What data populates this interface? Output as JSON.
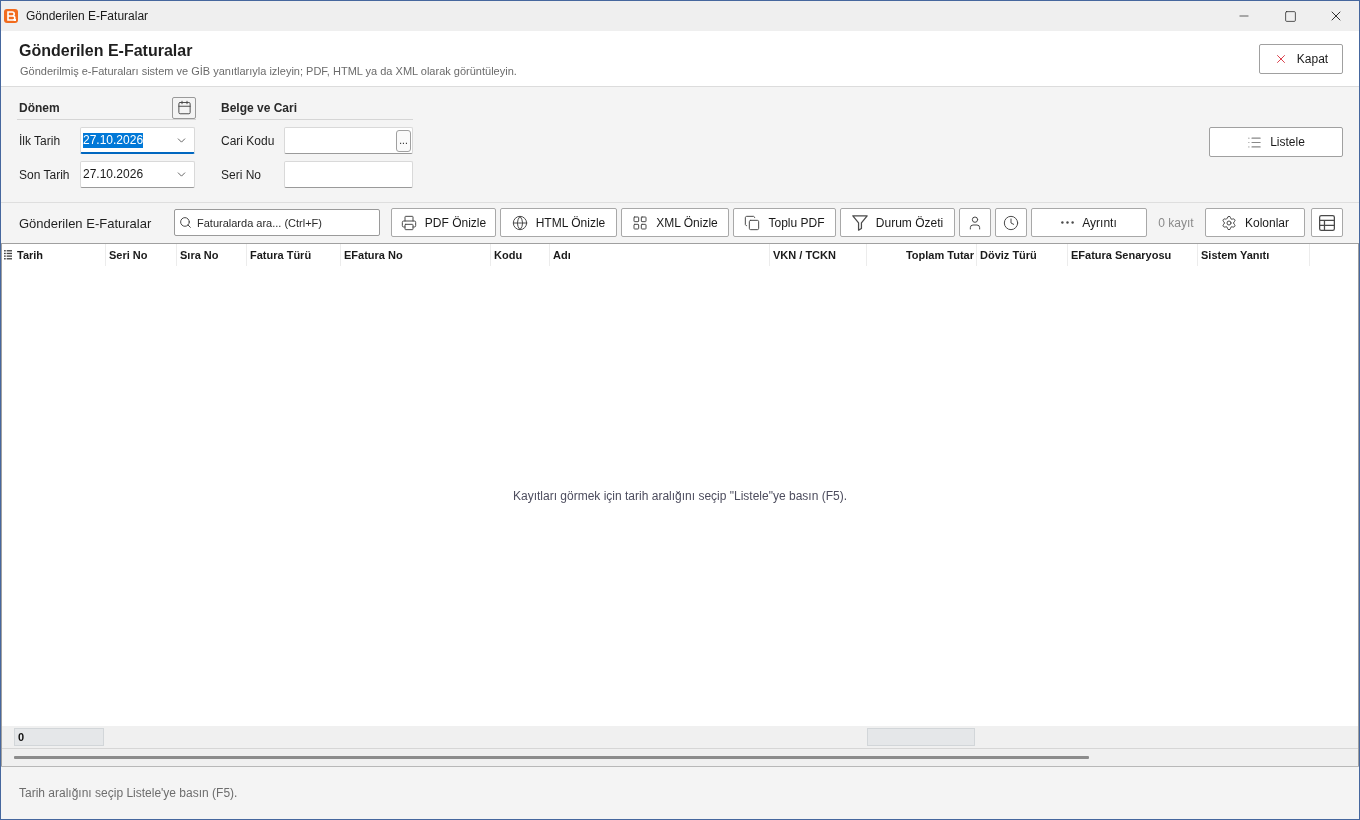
{
  "window": {
    "title": "Gönderilen E-Faturalar"
  },
  "header": {
    "title": "Gönderilen E-Faturalar",
    "subtitle": "Gönderilmiş e-Faturaları sistem ve GİB yanıtlarıyla izleyin; PDF, HTML ya da XML olarak görüntüleyin.",
    "close_button": "Kapat"
  },
  "filters": {
    "period": {
      "title": "Dönem",
      "fields": [
        {
          "label": "İlk Tarih",
          "value": "27.10.2026",
          "focused": true
        },
        {
          "label": "Son Tarih",
          "value": "27.10.2026",
          "focused": false
        }
      ]
    },
    "document": {
      "title": "Belge ve Cari",
      "fields": [
        {
          "label": "Cari Kodu",
          "kind": "lookup",
          "lookup_button": "..."
        },
        {
          "label": "Seri No",
          "kind": "text"
        }
      ]
    },
    "list_button": "Listele"
  },
  "toolbar": {
    "title": "Gönderilen E-Faturalar",
    "search": {
      "placeholder": "Faturalarda ara... (Ctrl+F)"
    },
    "items": [
      {
        "kind": "button",
        "label": "PDF Önizle"
      },
      {
        "kind": "button",
        "label": "HTML Önizle"
      },
      {
        "kind": "button",
        "label": "XML Önizle"
      },
      {
        "kind": "button",
        "label": "Toplu PDF"
      },
      {
        "kind": "button",
        "label": "Durum Özeti"
      },
      {
        "kind": "icon_button"
      },
      {
        "kind": "icon_button"
      },
      {
        "kind": "button",
        "label": "Ayrıntı"
      },
      {
        "kind": "count",
        "label": "0 kayıt"
      },
      {
        "kind": "button",
        "label": "Kolonlar"
      },
      {
        "kind": "icon_button"
      }
    ]
  },
  "table": {
    "columns": [
      {
        "label": "Tarih",
        "kind": "text"
      },
      {
        "label": "Seri No",
        "kind": "text"
      },
      {
        "label": "Sıra No",
        "kind": "text"
      },
      {
        "label": "Fatura Türü",
        "kind": "text"
      },
      {
        "label": "EFatura No",
        "kind": "text"
      },
      {
        "label": "Kodu",
        "kind": "text"
      },
      {
        "label": "Adı",
        "kind": "text"
      },
      {
        "label": "VKN / TCKN",
        "kind": "text"
      },
      {
        "label": "Toplam Tutar",
        "kind": "number"
      },
      {
        "label": "Döviz Türü",
        "kind": "text"
      },
      {
        "label": "EFatura Senaryosu",
        "kind": "text"
      },
      {
        "label": "Sistem Yanıtı",
        "kind": "text"
      }
    ],
    "empty_message": "Kayıtları görmek için tarih aralığını seçip \"Listele\"ye basın (F5).",
    "summary": {
      "count": "0"
    }
  },
  "status_bar": {
    "text": "Tarih aralığını seçip Listele'ye basın (F5)."
  }
}
